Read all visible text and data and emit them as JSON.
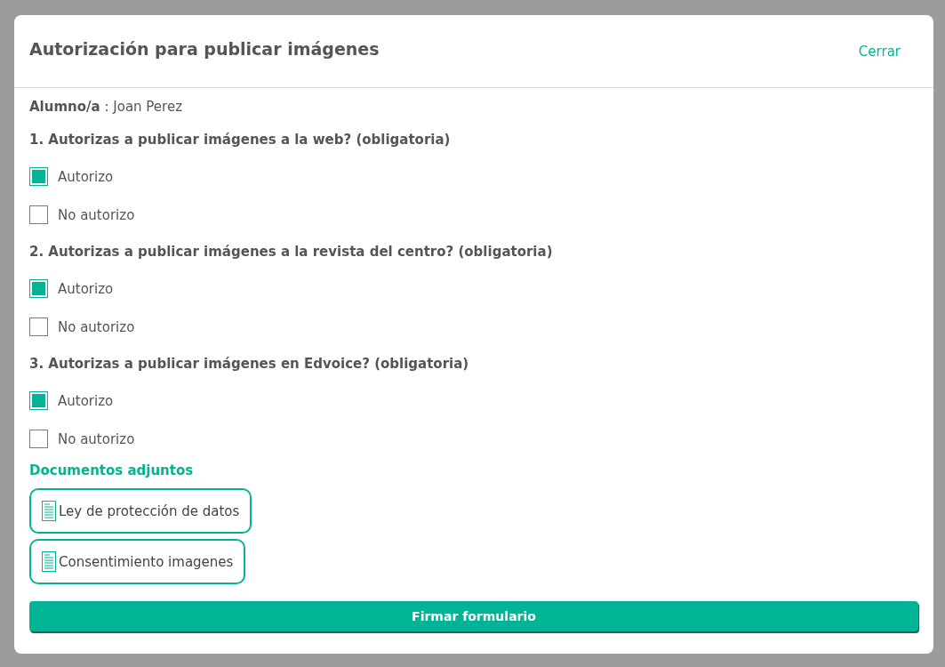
{
  "dialog": {
    "title": "Autorización para publicar imágenes",
    "close_label": "Cerrar"
  },
  "student": {
    "label": "Alumno/a",
    "separator": ":",
    "name": "Joan Perez"
  },
  "questions": [
    {
      "text": "1. Autorizas a publicar imágenes a la web? (obligatoria)",
      "options": [
        {
          "label": "Autorizo",
          "checked": true
        },
        {
          "label": "No autorizo",
          "checked": false
        }
      ]
    },
    {
      "text": "2. Autorizas a publicar imágenes a la revista del centro? (obligatoria)",
      "options": [
        {
          "label": "Autorizo",
          "checked": true
        },
        {
          "label": "No autorizo",
          "checked": false
        }
      ]
    },
    {
      "text": "3. Autorizas a publicar imágenes en Edvoice? (obligatoria)",
      "options": [
        {
          "label": "Autorizo",
          "checked": true
        },
        {
          "label": "No autorizo",
          "checked": false
        }
      ]
    }
  ],
  "attachments": {
    "heading": "Documentos adjuntos",
    "items": [
      "Ley de protección de datos",
      "Consentimiento imagenes"
    ]
  },
  "submit_label": "Firmar formulario"
}
